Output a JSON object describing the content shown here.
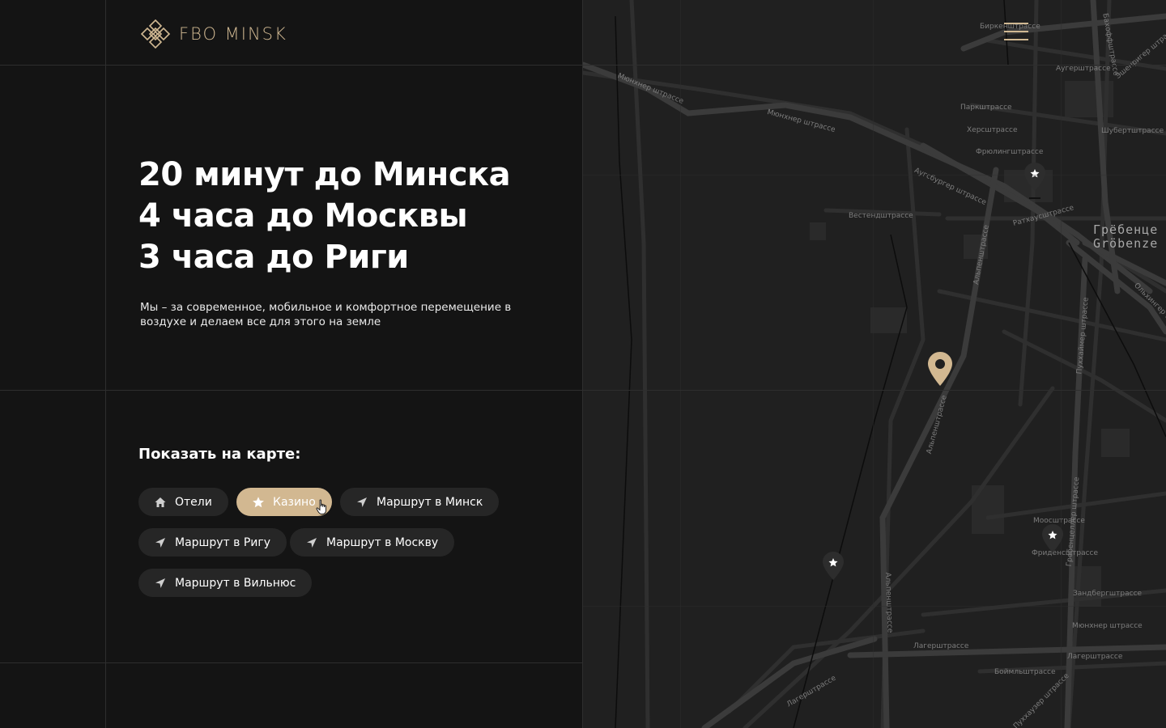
{
  "brand": {
    "logo_text": "FBO MINSK",
    "logo_icon": "ornament-logo-icon",
    "accent_color": "#d2b891"
  },
  "header": {
    "menu_icon": "hamburger-menu-icon"
  },
  "hero": {
    "lines": [
      "20 минут до Минска",
      "4 часа до Москвы",
      "3 часа до Риги"
    ],
    "subtitle": "Мы – за современное, мобильное и комфортное перемещение в воздухе и делаем все для этого на земле"
  },
  "filters": {
    "title": "Показать на карте:",
    "items": [
      {
        "label": "Отели",
        "icon": "home-icon",
        "active": false
      },
      {
        "label": "Казино",
        "icon": "star-icon",
        "active": true
      },
      {
        "label": "Маршрут в Минск",
        "icon": "navigation-arrow-icon",
        "active": false
      },
      {
        "label": "Маршрут в Ригу",
        "icon": "navigation-arrow-icon",
        "active": false
      },
      {
        "label": "Маршрут в Москву",
        "icon": "navigation-arrow-icon",
        "active": false
      },
      {
        "label": "Маршрут в Вильнюс",
        "icon": "navigation-arrow-icon",
        "active": false
      }
    ]
  },
  "map": {
    "district": [
      "Грёбенце",
      "Gröbenze"
    ],
    "streets": {
      "s1": "Биркенштрассе",
      "s2": "Мюнхнер штрассе",
      "s3": "Мюнхнер штрассе",
      "s4": "Аугсбургер штрассе",
      "s5": "Паркштрассе",
      "s6": "Херсштрассе",
      "s7": "Фрюлингштрассе",
      "s8": "Шубертштрассе",
      "s9": "Альпенштрассе",
      "s10": "Альпенштрассе",
      "s11": "Альпенштрассе",
      "s12": "Лагерштрассе",
      "s13": "Лагерштрассе",
      "s14": "Гребенцеллер штрассе",
      "s15": "Пуххаймер штрассе",
      "s16": "Моосштрассе",
      "s17": "Фриденсштрассе",
      "s18": "Зандбергштрассе",
      "s19": "Мюнхнер штрассе",
      "s20": "Боймльштрассе",
      "s21": "Пуххаузер штрассе",
      "s22": "Вестендштрассе",
      "s23": "Ратхаусштрассе",
      "s24": "Эшенригер штрассе",
      "s25": "Ольхингер штрассе",
      "s26": "Бахоффштрассе",
      "s27": "Лагерштрассе",
      "s28": "Аугерштрассе"
    },
    "markers": [
      {
        "type": "location-pin-icon",
        "color": "#d2b891"
      },
      {
        "type": "star-pin-icon"
      },
      {
        "type": "star-pin-icon"
      },
      {
        "type": "star-pin-icon"
      }
    ]
  }
}
